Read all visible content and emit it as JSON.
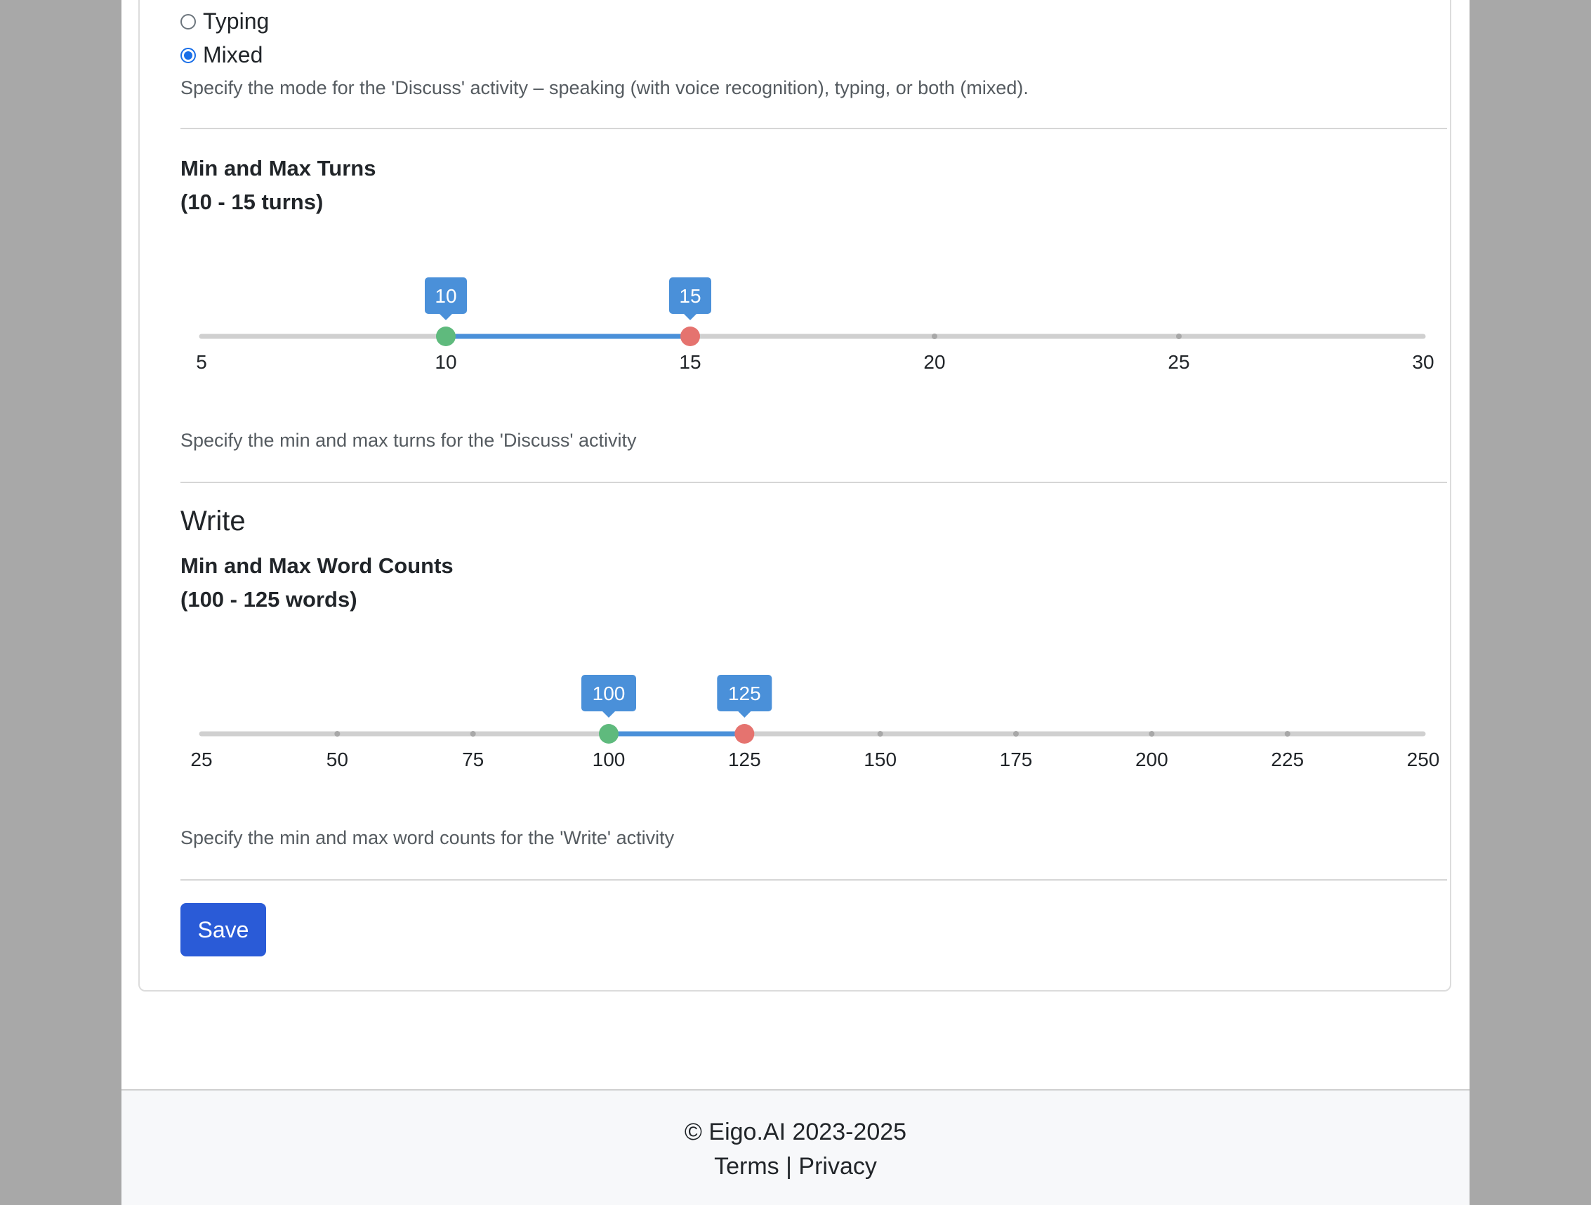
{
  "mode_options": [
    {
      "label": "Typing",
      "checked": false
    },
    {
      "label": "Mixed",
      "checked": true
    }
  ],
  "mode_help": "Specify the mode for the 'Discuss' activity – speaking (with voice recognition), typing, or both (mixed).",
  "turns": {
    "title": "Min and Max Turns",
    "range_text": "(10 - 15 turns)",
    "min": 5,
    "max": 30,
    "low": 10,
    "high": 15,
    "ticks": [
      5,
      10,
      15,
      20,
      25,
      30
    ],
    "low_label": "10",
    "high_label": "15",
    "help": "Specify the min and max turns for the 'Discuss' activity"
  },
  "write": {
    "section_title": "Write",
    "title": "Min and Max Word Counts",
    "range_text": "(100 - 125 words)",
    "min": 25,
    "max": 250,
    "low": 100,
    "high": 125,
    "ticks": [
      25,
      50,
      75,
      100,
      125,
      150,
      175,
      200,
      225,
      250
    ],
    "low_label": "100",
    "high_label": "125",
    "help": "Specify the min and max word counts for the 'Write' activity"
  },
  "save_label": "Save",
  "footer": {
    "copyright": "© Eigo.AI 2023-2025",
    "terms": "Terms",
    "separator": "|",
    "privacy": "Privacy"
  },
  "colors": {
    "accent": "#4a90d9",
    "low_handle": "#5fba7d",
    "high_handle": "#e5736f",
    "track": "#d0d0d0",
    "save": "#2a5bd7"
  }
}
